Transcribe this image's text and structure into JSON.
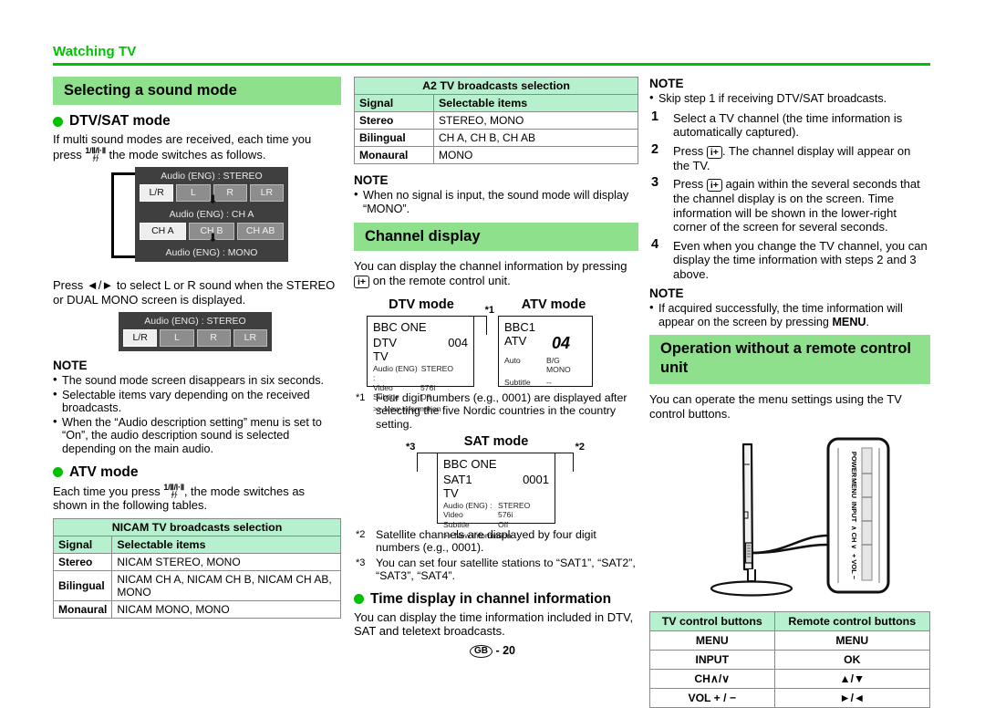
{
  "running_head": "Watching TV",
  "footer": {
    "region": "GB",
    "page": "- 20"
  },
  "colors": {
    "accent_green": "#00c000",
    "bar_green": "#8ee08c",
    "table_header": "#b6f0cf"
  },
  "col1": {
    "section_title": "Selecting a sound mode",
    "dtv_heading": "DTV/SAT mode",
    "dtv_intro_a": "If multi sound modes are received, each time you press",
    "dtv_intro_b": "the mode switches as follows.",
    "flow": [
      {
        "caption": "Audio (ENG) : STEREO",
        "buttons": [
          "L/R",
          "L",
          "R",
          "LR"
        ],
        "selected": 0
      },
      {
        "caption": "Audio (ENG) : CH A",
        "buttons": [
          "CH A",
          "CH B",
          "CH AB"
        ],
        "selected": 0
      },
      {
        "caption": "Audio (ENG) : MONO",
        "buttons": [],
        "selected": -1
      }
    ],
    "press_text": "to select L or R sound when the STEREO or DUAL MONO screen is displayed.",
    "press_keys": "◄/►",
    "osd_repeat": {
      "caption": "Audio (ENG) : STEREO",
      "buttons": [
        "L/R",
        "L",
        "R",
        "LR"
      ],
      "selected": 0
    },
    "note_title": "NOTE",
    "notes": [
      "The sound mode screen disappears in six seconds.",
      "Selectable items vary depending on the received broadcasts.",
      "When the “Audio description setting” menu is set to “On”, the audio description sound is selected depending on the main audio."
    ],
    "atv_heading": "ATV mode",
    "atv_intro_a": "Each time you press",
    "atv_intro_b": ", the mode switches as shown in the following tables.",
    "nicam_table": {
      "title": "NICAM TV broadcasts selection",
      "headers": [
        "Signal",
        "Selectable items"
      ],
      "rows": [
        [
          "Stereo",
          "NICAM STEREO, MONO"
        ],
        [
          "Bilingual",
          "NICAM CH A, NICAM CH B, NICAM CH AB, MONO"
        ],
        [
          "Monaural",
          "NICAM MONO, MONO"
        ]
      ]
    }
  },
  "col2": {
    "a2_table": {
      "title": "A2 TV broadcasts selection",
      "headers": [
        "Signal",
        "Selectable items"
      ],
      "rows": [
        [
          "Stereo",
          "STEREO, MONO"
        ],
        [
          "Bilingual",
          "CH A, CH B, CH AB"
        ],
        [
          "Monaural",
          "MONO"
        ]
      ]
    },
    "note_title": "NOTE",
    "notes": [
      "When no signal is input, the sound mode will display “MONO”."
    ],
    "section_title": "Channel display",
    "intro_a": "You can display the channel information by pressing",
    "intro_b": "on the remote control unit.",
    "info_key": "i+",
    "dtv_mode_title": "DTV mode",
    "atv_mode_title": "ATV mode",
    "dtv_screen": {
      "channel_name": "BBC ONE",
      "source": "DTV",
      "type": "TV",
      "number": "004",
      "marker": "*1",
      "rows": [
        {
          "label": "Audio (ENG)  :",
          "value": "STEREO"
        },
        {
          "label": "Video",
          "value": "576i"
        },
        {
          "label": "Subtitle",
          "value": "Off"
        }
      ],
      "footer_line": ">> New information"
    },
    "atv_screen": {
      "channel_name": "BBC1",
      "source": "ATV",
      "number": "04",
      "rows": [
        {
          "label": "Auto",
          "value": "B/G"
        },
        {
          "label": "",
          "value": "MONO"
        },
        {
          "label": "Subtitle",
          "value": "--"
        }
      ]
    },
    "footnote1": {
      "mark": "*1",
      "text": "Four digit numbers (e.g., 0001) are displayed after selecting the five Nordic countries in the country setting."
    },
    "sat_mode_title": "SAT mode",
    "sat_screen": {
      "channel_name": "BBC ONE",
      "source": "SAT1",
      "type": "TV",
      "number": "0001",
      "marker_left": "*3",
      "marker_right": "*2",
      "rows": [
        {
          "label": "Audio (ENG)  :",
          "value": "STEREO"
        },
        {
          "label": "Video",
          "value": "576i"
        },
        {
          "label": "Subtitle",
          "value": "Off"
        }
      ],
      "footer_line": ">> New information"
    },
    "footnote2": {
      "mark": "*2",
      "text": "Satellite channels are displayed by four digit numbers (e.g., 0001)."
    },
    "footnote3": {
      "mark": "*3",
      "text": "You can set four satellite stations to “SAT1”, “SAT2”, “SAT3”, “SAT4”."
    },
    "time_heading": "Time display in channel information",
    "time_text": "You can display the time information included in DTV, SAT and teletext broadcasts."
  },
  "col3": {
    "note_title_1": "NOTE",
    "note_1": "Skip step 1 if receiving DTV/SAT broadcasts.",
    "steps": [
      {
        "num": "1",
        "text": "Select a TV channel (the time information is automatically captured)."
      },
      {
        "num": "2",
        "text_a": "Press",
        "key": "i+",
        "text_b": ". The channel display will appear on the TV."
      },
      {
        "num": "3",
        "text_a": "Press",
        "key": "i+",
        "text_b": "again within the several seconds that the channel display is on the screen. Time information will be shown in the lower-right corner of the screen for several seconds."
      },
      {
        "num": "4",
        "text": "Even when you change the TV channel, you can display the time information with steps 2 and 3 above."
      }
    ],
    "note_title_2": "NOTE",
    "note_2_a": "If acquired successfully, the time information will appear on the screen by pressing",
    "note_2_bold": "MENU",
    "note_2_b": ".",
    "section_title": "Operation without a remote control unit",
    "intro": "You can operate the menu settings using the TV control buttons.",
    "tv_panel_labels": [
      "POWER",
      "MENU",
      "INPUT",
      "CH ∧/∨",
      "VOL +/−"
    ],
    "ctrl_table": {
      "headers": [
        "TV control buttons",
        "Remote control buttons"
      ],
      "rows": [
        [
          "MENU",
          "MENU"
        ],
        [
          "INPUT",
          "OK"
        ],
        [
          "CH∧/∨",
          "▲/▼"
        ],
        [
          "VOL + / −",
          "►/◄"
        ]
      ]
    }
  }
}
